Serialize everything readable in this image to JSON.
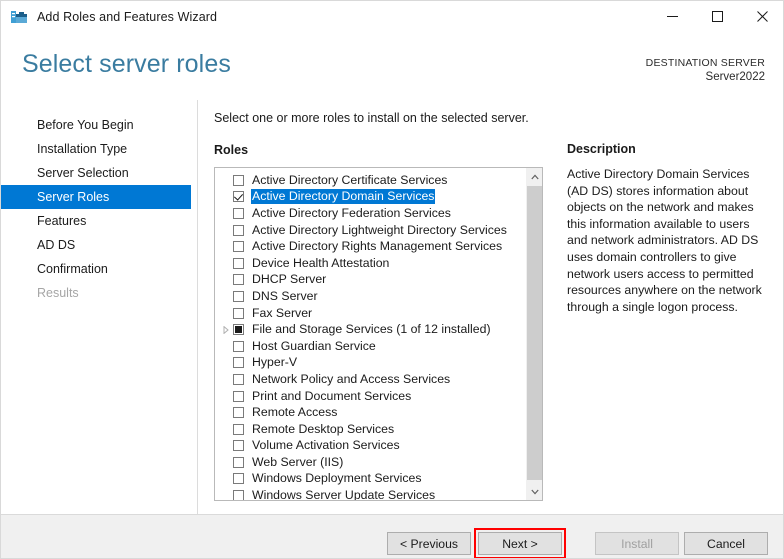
{
  "window": {
    "title": "Add Roles and Features Wizard",
    "icon": "server-roles-wizard-icon",
    "minimize_label": "─",
    "maximize_label": "□",
    "close_label": "✕"
  },
  "header": {
    "page_title": "Select server roles",
    "destination_label": "DESTINATION SERVER",
    "destination_server": "Server2022"
  },
  "sidebar": {
    "items": [
      {
        "label": "Before You Begin",
        "state": "normal"
      },
      {
        "label": "Installation Type",
        "state": "normal"
      },
      {
        "label": "Server Selection",
        "state": "normal"
      },
      {
        "label": "Server Roles",
        "state": "selected"
      },
      {
        "label": "Features",
        "state": "normal"
      },
      {
        "label": "AD DS",
        "state": "normal"
      },
      {
        "label": "Confirmation",
        "state": "normal"
      },
      {
        "label": "Results",
        "state": "disabled"
      }
    ]
  },
  "main": {
    "instruction": "Select one or more roles to install on the selected server.",
    "roles_label": "Roles",
    "roles": [
      {
        "label": "Active Directory Certificate Services",
        "checked": false,
        "partial": false,
        "selected": false,
        "expandable": false
      },
      {
        "label": "Active Directory Domain Services",
        "checked": true,
        "partial": false,
        "selected": true,
        "expandable": false
      },
      {
        "label": "Active Directory Federation Services",
        "checked": false,
        "partial": false,
        "selected": false,
        "expandable": false
      },
      {
        "label": "Active Directory Lightweight Directory Services",
        "checked": false,
        "partial": false,
        "selected": false,
        "expandable": false
      },
      {
        "label": "Active Directory Rights Management Services",
        "checked": false,
        "partial": false,
        "selected": false,
        "expandable": false
      },
      {
        "label": "Device Health Attestation",
        "checked": false,
        "partial": false,
        "selected": false,
        "expandable": false
      },
      {
        "label": "DHCP Server",
        "checked": false,
        "partial": false,
        "selected": false,
        "expandable": false
      },
      {
        "label": "DNS Server",
        "checked": false,
        "partial": false,
        "selected": false,
        "expandable": false
      },
      {
        "label": "Fax Server",
        "checked": false,
        "partial": false,
        "selected": false,
        "expandable": false
      },
      {
        "label": "File and Storage Services (1 of 12 installed)",
        "checked": false,
        "partial": true,
        "selected": false,
        "expandable": true
      },
      {
        "label": "Host Guardian Service",
        "checked": false,
        "partial": false,
        "selected": false,
        "expandable": false
      },
      {
        "label": "Hyper-V",
        "checked": false,
        "partial": false,
        "selected": false,
        "expandable": false
      },
      {
        "label": "Network Policy and Access Services",
        "checked": false,
        "partial": false,
        "selected": false,
        "expandable": false
      },
      {
        "label": "Print and Document Services",
        "checked": false,
        "partial": false,
        "selected": false,
        "expandable": false
      },
      {
        "label": "Remote Access",
        "checked": false,
        "partial": false,
        "selected": false,
        "expandable": false
      },
      {
        "label": "Remote Desktop Services",
        "checked": false,
        "partial": false,
        "selected": false,
        "expandable": false
      },
      {
        "label": "Volume Activation Services",
        "checked": false,
        "partial": false,
        "selected": false,
        "expandable": false
      },
      {
        "label": "Web Server (IIS)",
        "checked": false,
        "partial": false,
        "selected": false,
        "expandable": false
      },
      {
        "label": "Windows Deployment Services",
        "checked": false,
        "partial": false,
        "selected": false,
        "expandable": false
      },
      {
        "label": "Windows Server Update Services",
        "checked": false,
        "partial": false,
        "selected": false,
        "expandable": false
      }
    ],
    "scrollbar": {
      "up_icon": "chevron-up-icon",
      "down_icon": "chevron-down-icon"
    }
  },
  "description": {
    "title": "Description",
    "text": "Active Directory Domain Services (AD DS) stores information about objects on the network and makes this information available to users and network administrators. AD DS uses domain controllers to give network users access to permitted resources anywhere on the network through a single logon process."
  },
  "footer": {
    "previous": "< Previous",
    "next": "Next >",
    "install": "Install",
    "cancel": "Cancel",
    "install_disabled": true,
    "next_highlighted": true
  },
  "colors": {
    "accent": "#0078d4",
    "title_text": "#3a7ca0",
    "highlight_box": "#ff0000",
    "footer_bg": "#f0f0f0"
  }
}
